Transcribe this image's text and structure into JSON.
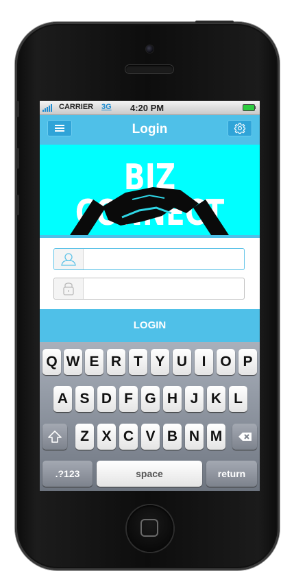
{
  "status_bar": {
    "carrier": "CARRIER",
    "network": "3G",
    "time": "4:20 PM"
  },
  "nav_bar": {
    "title": "Login",
    "menu_icon": "hamburger-icon",
    "settings_icon": "gear-icon"
  },
  "banner": {
    "title": "BIZ CONNECT",
    "background_color": "#00ffff",
    "image": "handshake"
  },
  "form": {
    "username": {
      "icon": "user-icon",
      "value": "",
      "placeholder": ""
    },
    "password": {
      "icon": "lock-icon",
      "value": "",
      "placeholder": ""
    },
    "login_label": "LOGIN"
  },
  "keyboard": {
    "row1": [
      "Q",
      "W",
      "E",
      "R",
      "T",
      "Y",
      "U",
      "I",
      "O",
      "P"
    ],
    "row2": [
      "A",
      "S",
      "D",
      "F",
      "G",
      "H",
      "J",
      "K",
      "L"
    ],
    "row3": [
      "Z",
      "X",
      "C",
      "V",
      "B",
      "N",
      "M"
    ],
    "shift_icon": "shift-arrow-icon",
    "delete_icon": "backspace-icon",
    "numbers_label": ".?123",
    "space_label": "space",
    "return_label": "return"
  },
  "colors": {
    "accent": "#4fc0e8",
    "accent_dark": "#2fa4d8",
    "banner": "#00ffff"
  }
}
